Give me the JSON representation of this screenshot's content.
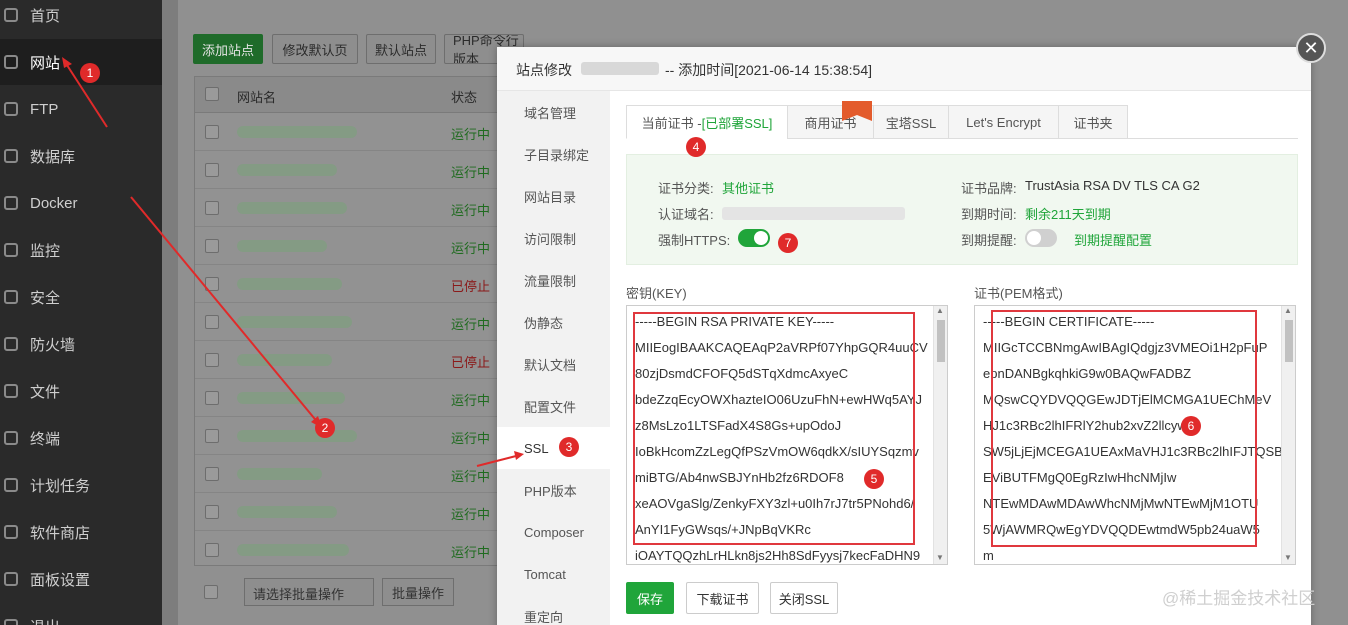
{
  "sidebar": {
    "items": [
      {
        "label": "首页",
        "icon": "home-icon"
      },
      {
        "label": "网站",
        "icon": "globe-icon"
      },
      {
        "label": "FTP",
        "icon": "ftp-icon"
      },
      {
        "label": "数据库",
        "icon": "database-icon"
      },
      {
        "label": "Docker",
        "icon": "docker-icon"
      },
      {
        "label": "监控",
        "icon": "monitor-icon"
      },
      {
        "label": "安全",
        "icon": "shield-icon"
      },
      {
        "label": "防火墙",
        "icon": "firewall-icon"
      },
      {
        "label": "文件",
        "icon": "folder-icon"
      },
      {
        "label": "终端",
        "icon": "terminal-icon"
      },
      {
        "label": "计划任务",
        "icon": "calendar-icon"
      },
      {
        "label": "软件商店",
        "icon": "grid-icon"
      },
      {
        "label": "面板设置",
        "icon": "settings-icon"
      },
      {
        "label": "退出",
        "icon": "logout-icon"
      }
    ]
  },
  "toolbar": {
    "add_site": "添加站点",
    "edit_default": "修改默认页",
    "default_site": "默认站点",
    "php_cmd": "PHP命令行版本"
  },
  "table": {
    "col_name": "网站名",
    "col_status": "状态",
    "rows": [
      {
        "status": "运行中"
      },
      {
        "status": "运行中"
      },
      {
        "status": "运行中"
      },
      {
        "status": "运行中"
      },
      {
        "status": "已停止"
      },
      {
        "status": "运行中"
      },
      {
        "status": "已停止"
      },
      {
        "status": "运行中"
      },
      {
        "status": "运行中"
      },
      {
        "status": "运行中"
      },
      {
        "status": "运行中"
      },
      {
        "status": "运行中"
      }
    ],
    "batch_placeholder": "请选择批量操作",
    "batch_button": "批量操作"
  },
  "modal": {
    "title_prefix": "站点修改",
    "title_suffix": "-- 添加时间[2021-06-14 15:38:54]",
    "nav": [
      "域名管理",
      "子目录绑定",
      "网站目录",
      "访问限制",
      "流量限制",
      "伪静态",
      "默认文档",
      "配置文件",
      "SSL",
      "PHP版本",
      "Composer",
      "Tomcat",
      "重定向"
    ],
    "tabs": {
      "current_prefix": "当前证书 - ",
      "current_status": "[已部署SSL]",
      "commercial": "商用证书",
      "baota": "宝塔SSL",
      "letsencrypt": "Let's Encrypt",
      "folder": "证书夹"
    },
    "cert_info": {
      "category_label": "证书分类:",
      "category_value": "其他证书",
      "domain_label": "认证域名:",
      "https_label": "强制HTTPS:",
      "brand_label": "证书品牌:",
      "brand_value": "TrustAsia RSA DV TLS CA G2",
      "expire_label": "到期时间:",
      "expire_value": "剩余211天到期",
      "reminder_label": "到期提醒:",
      "reminder_link": "到期提醒配置"
    },
    "key": {
      "label": "密钥(KEY)",
      "lines": [
        "-----BEGIN RSA PRIVATE KEY-----",
        "MIIEogIBAAKCAQEAqP2aVRPf07YhpGQR4uuCV",
        "80zjDsmdCFOFQ5dSTqXdmcAxyeC",
        "bdeZzqEcyOWXhazteIO06UzuFhN+ewHWq5AYJ",
        "z8MsLzo1LTSFadX4S8Gs+upOdoJ",
        "IoBkHcomZzLegQfPSzVmOW6qdkX/sIUYSqzmv",
        "miBTG/Ab4nwSBJYnHb2fz6RDOF8",
        "xeAOVgaSlg/ZenkyFXY3zl+u0Ih7rJ7tr5PNohd6/",
        "AnYI1FyGWsqs/+JNpBqVKRc",
        "iOAYTQQzhLrHLkn8js2Hh8SdFyysj7kecFaDHN9"
      ]
    },
    "cert": {
      "label": "证书(PEM格式)",
      "lines": [
        "-----BEGIN CERTIFICATE-----",
        "MIIGcTCCBNmgAwIBAgIQdgjz3VMEOi1H2pFuP",
        "epnDANBgkqhkiG9w0BAQwFADBZ",
        "MQswCQYDVQQGEwJDTjElMCMGA1UEChMeV",
        "HJ1c3RBc2lhIFRlY2hub2xvZ2llcyw",
        "SW5jLjEjMCEGA1UEAxMaVHJ1c3RBc2lhIFJTQSB",
        "EViBUTFMgQ0EgRzIwHhcNMjIw",
        "NTEwMDAwMDAwWhcNMjMwNTEwMjM1OTU",
        "5WjAWMRQwEgYDVQQDEwtmdW5pb24uaW5",
        "m"
      ]
    },
    "buttons": {
      "save": "保存",
      "download": "下载证书",
      "close_ssl": "关闭SSL"
    }
  },
  "annotations": [
    "1",
    "2",
    "3",
    "4",
    "5",
    "6",
    "7"
  ],
  "watermark": "@稀土掘金技术社区"
}
